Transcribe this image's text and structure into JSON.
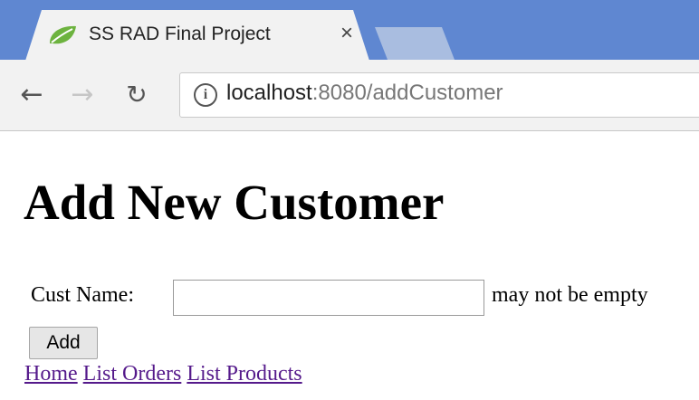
{
  "browser": {
    "tab_title": "SS RAD Final Project",
    "tab_close": "×",
    "url_host": "localhost",
    "url_rest": ":8080/addCustomer"
  },
  "page": {
    "title": "Add New Customer",
    "form": {
      "name_label": "Cust Name:",
      "name_value": "",
      "error": "may not be empty",
      "submit_label": "Add"
    },
    "links": [
      {
        "label": "Home"
      },
      {
        "label": "List Orders"
      },
      {
        "label": "List Products"
      }
    ]
  },
  "colors": {
    "tabstrip": "#5f87d1",
    "visited_link": "#551a8b"
  }
}
